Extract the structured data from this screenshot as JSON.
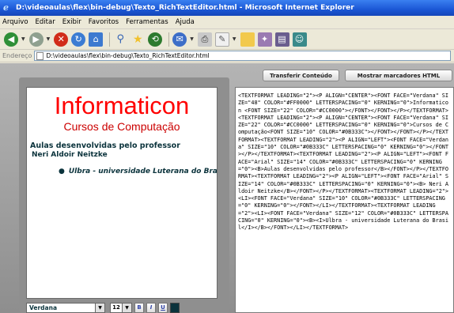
{
  "window": {
    "title": "D:\\videoaulas\\flex\\bin-debug\\Texto_RichTextEditor.html - Microsoft Internet Explorer"
  },
  "menu": [
    "Arquivo",
    "Editar",
    "Exibir",
    "Favoritos",
    "Ferramentas",
    "Ajuda"
  ],
  "address": {
    "label": "Endereço",
    "value": "D:\\videoaulas\\flex\\bin-debug\\Texto_RichTextEditor.html"
  },
  "buttons": {
    "transfer": "Transferir Conteúdo",
    "markers": "Mostrar marcadores HTML"
  },
  "editor": {
    "title": "Informaticon",
    "subtitle": "Cursos de Computação",
    "line1": "Aulas desenvolvidas pelo professor",
    "line2": "Neri Aldoir Neitzke",
    "bullet": "Ulbra - universidade Luterana do Brasil",
    "font": "Verdana",
    "size": "12",
    "bold": "B",
    "italic": "I",
    "underline": "U",
    "text_color": "#0B333C"
  },
  "html_source": "<TEXTFORMAT LEADING=\"2\"><P ALIGN=\"CENTER\"><FONT FACE=\"Verdana\" SIZE=\"48\" COLOR=\"#FF0000\" LETTERSPACING=\"0\" KERNING=\"0\">Informaticon <FONT SIZE=\"22\" COLOR=\"#CC0000\"></FONT></FONT></P></TEXTFORMAT><TEXTFORMAT LEADING=\"2\"><P ALIGN=\"CENTER\"><FONT FACE=\"Verdana\" SIZE=\"22\" COLOR=\"#CC0000\" LETTERSPACING=\"0\" KERNING=\"0\">Cursos de Computação<FONT SIZE=\"10\" COLOR=\"#0B333C\"></FONT></FONT></P></TEXTFORMAT><TEXTFORMAT LEADING=\"2\"><P ALIGN=\"LEFT\"><FONT FACE=\"Verdana\" SIZE=\"10\" COLOR=\"#0B333C\" LETTERSPACING=\"0\" KERNING=\"0\"></FONT></P></TEXTFORMAT><TEXTFORMAT LEADING=\"2\"><P ALIGN=\"LEFT\"><FONT FACE=\"Arial\" SIZE=\"14\" COLOR=\"#0B333C\" LETTERSPACING=\"0\" KERNING=\"0\"><B>Aulas desenvolvidas pelo professor</B></FONT></P></TEXTFORMAT><TEXTFORMAT LEADING=\"2\"><P ALIGN=\"LEFT\"><FONT FACE=\"Arial\" SIZE=\"14\" COLOR=\"#0B333C\" LETTERSPACING=\"0\" KERNING=\"0\"><B> Neri Aldoir Neitzke</B></FONT></P></TEXTFORMAT><TEXTFORMAT LEADING=\"2\"><LI><FONT FACE=\"Verdana\" SIZE=\"10\" COLOR=\"#0B333C\" LETTERSPACING=\"0\" KERNING=\"0\"></FONT></LI></TEXTFORMAT><TEXTFORMAT LEADING=\"2\"><LI><FONT FACE=\"Verdana\" SIZE=\"12\" COLOR=\"#0B333C\" LETTERSPACING=\"0\" KERNING=\"0\"><B><I>Ulbra - universidade Luterana do Brasil</I></B></FONT></LI></TEXTFORMAT>"
}
